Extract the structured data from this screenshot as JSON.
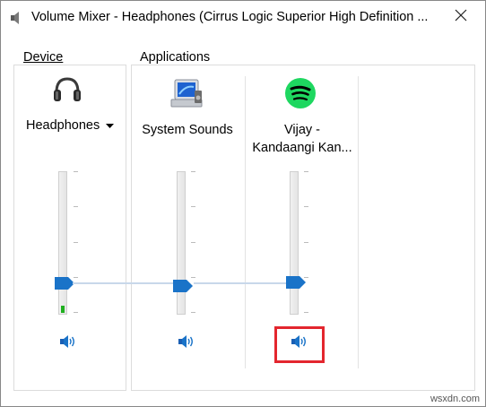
{
  "window": {
    "title": "Volume Mixer - Headphones (Cirrus Logic Superior High Definition ...",
    "app_icon": "speaker-icon",
    "close_icon": "close-icon"
  },
  "device_group": {
    "label": "Device",
    "channel": {
      "name": "Headphones",
      "icon": "headphones-icon",
      "has_dropdown": true,
      "volume_level": 0.18,
      "peak_meter": true
    }
  },
  "applications_group": {
    "label": "Applications",
    "channels": [
      {
        "name": "System Sounds",
        "icon": "system-sounds-icon",
        "volume_level": 0.18
      },
      {
        "name": "Vijay -\nKandaangi Kan...",
        "name_line1": "Vijay -",
        "name_line2": "Kandaangi Kan...",
        "icon": "spotify-icon",
        "volume_level": 0.18
      }
    ]
  },
  "mute_icon": "speaker-unmuted-icon",
  "highlight_color": "#e3262e",
  "accent_color": "#1a73c8",
  "watermark": "wsxdn.com"
}
